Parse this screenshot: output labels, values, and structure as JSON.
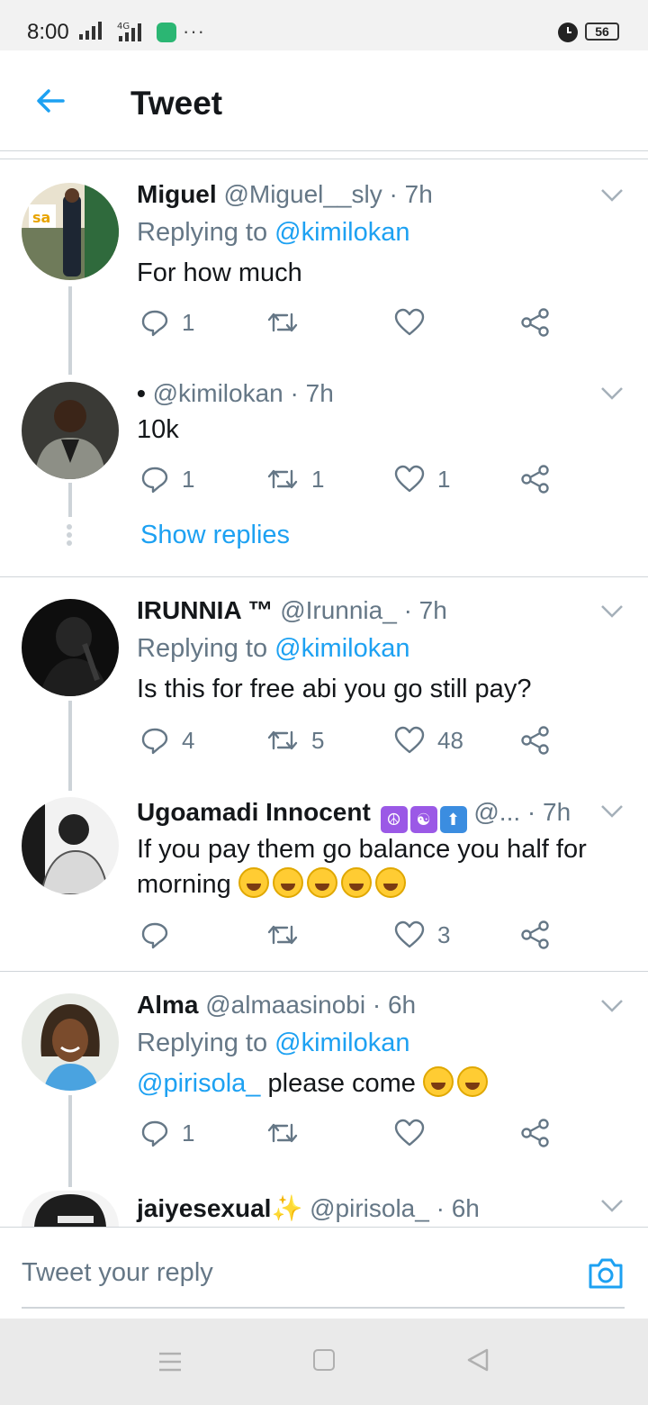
{
  "status_bar": {
    "time": "8:00",
    "network": "4G",
    "battery": "56",
    "more": "···"
  },
  "header": {
    "title": "Tweet",
    "back_icon": "arrow-left-icon"
  },
  "colors": {
    "accent": "#1da1f2",
    "secondary_text": "#657786",
    "divider": "#d0d5d9"
  },
  "tweets": [
    {
      "name": "Miguel",
      "handle": "@Miguel__sly",
      "time": "· 7h",
      "replying_label": "Replying to",
      "replying_to": "@kimilokan",
      "text": "For how much",
      "replies": "1",
      "retweets": "",
      "likes": ""
    },
    {
      "name": "•",
      "handle": "@kimilokan",
      "time": "· 7h",
      "text": "10k",
      "replies": "1",
      "retweets": "1",
      "likes": "1"
    },
    {
      "name": "IRUNNIA ™",
      "handle": "@Irunnia_",
      "time": "· 7h",
      "replying_label": "Replying to",
      "replying_to": "@kimilokan",
      "text": "Is this for free abi you go still pay?",
      "replies": "4",
      "retweets": "5",
      "likes": "48"
    },
    {
      "name": "Ugoamadi Innocent",
      "handle": "@...",
      "time": "· 7h",
      "text_line1": "If you pay them go balance you half for",
      "text_line2": "morning",
      "replies": "",
      "retweets": "",
      "likes": "3"
    },
    {
      "name": "Alma",
      "handle": "@almaasinobi",
      "time": "· 6h",
      "replying_label": "Replying to",
      "replying_to": "@kimilokan",
      "text_mention": "@pirisola_",
      "text": " please come",
      "replies": "1",
      "retweets": "",
      "likes": ""
    },
    {
      "name": "jaiyesexual",
      "handle": "@pirisola_",
      "time": "· 6h"
    }
  ],
  "show_replies": "Show replies",
  "composer": {
    "placeholder": "Tweet your reply",
    "camera_icon": "camera-icon"
  },
  "nav": {
    "menu_icon": "menu-icon",
    "home_icon": "home-square-icon",
    "back_icon": "back-triangle-icon"
  }
}
